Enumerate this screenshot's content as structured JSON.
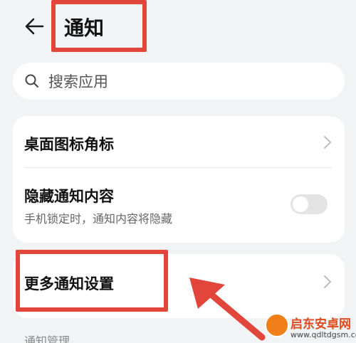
{
  "header": {
    "title": "通知"
  },
  "search": {
    "placeholder": "搜索应用"
  },
  "settings": {
    "desktop_badge": {
      "label": "桌面图标角标"
    },
    "hide_content": {
      "label": "隐藏通知内容",
      "description": "手机锁定时，通知内容将隐藏",
      "enabled": false
    },
    "more_settings": {
      "label": "更多通知设置"
    }
  },
  "section": {
    "notification_management": "通知管理"
  },
  "watermark": {
    "title": "启东安卓网",
    "url": "www.qdltdgsm.com"
  },
  "colors": {
    "annotation": "#e2453a",
    "background": "#f1f3f5",
    "card": "#ffffff"
  }
}
